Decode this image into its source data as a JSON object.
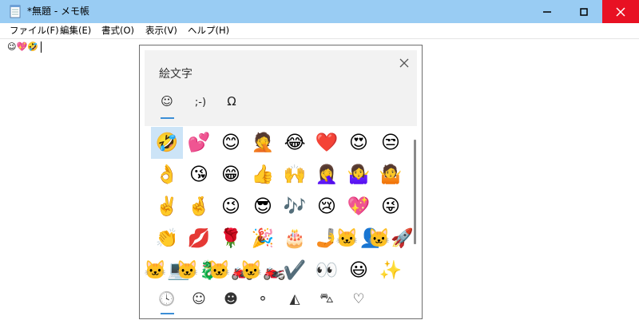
{
  "window": {
    "title": "*無題 - メモ帳",
    "title_bar_color": "#99CCF3",
    "close_color": "#E81123"
  },
  "menu": [
    {
      "label": "ファイル(F)"
    },
    {
      "label": "編集(E)"
    },
    {
      "label": "書式(O)"
    },
    {
      "label": "表示(V)"
    },
    {
      "label": "ヘルプ(H)"
    }
  ],
  "editor": {
    "content": "😉💖🤣"
  },
  "emoji_panel": {
    "title": "絵文字",
    "tabs": [
      {
        "label": "☺",
        "name": "tab-emoji"
      },
      {
        "label": ";-)",
        "name": "tab-kaomoji"
      },
      {
        "label": "Ω",
        "name": "tab-symbols"
      }
    ],
    "emojis": [
      "🤣",
      "💕",
      "😊",
      "🤦",
      "😂",
      "❤️",
      "😍",
      "😒",
      "👌",
      "😘",
      "😁",
      "👍",
      "🙌",
      "🤦‍♀️",
      "🤷‍♀️",
      "🤷",
      "✌️",
      "🤞",
      "😉",
      "😎",
      "🎶",
      "😢",
      "💖",
      "😜",
      "👏",
      "💋",
      "🌹",
      "🎉",
      "🎂",
      "🤳",
      "🐱‍👤",
      "🐱‍🚀",
      "🐱‍💻",
      "🐱‍🐉",
      "🐱‍🏍",
      "🐱‍🏍",
      "✔️",
      "👀",
      "😃",
      "✨"
    ],
    "selected_index": 0,
    "categories": [
      {
        "icon": "clock-icon",
        "glyph": "🕓"
      },
      {
        "icon": "smiley-icon",
        "glyph": "☺"
      },
      {
        "icon": "person-icon",
        "glyph": "☻"
      },
      {
        "icon": "balloon-icon",
        "glyph": "⚬"
      },
      {
        "icon": "pizza-icon",
        "glyph": "◭"
      },
      {
        "icon": "car-icon",
        "glyph": "⛍"
      },
      {
        "icon": "heart-icon",
        "glyph": "♡"
      }
    ],
    "accent_color": "#3C8ED6"
  }
}
